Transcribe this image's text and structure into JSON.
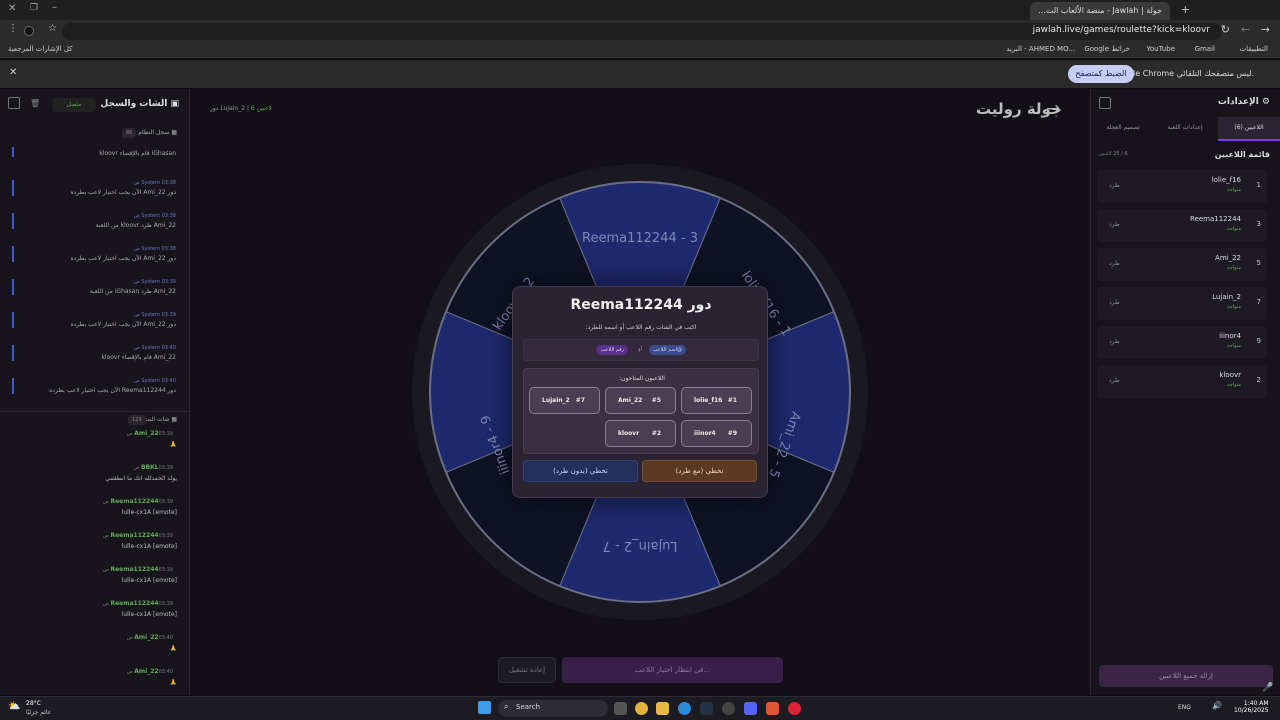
{
  "browser": {
    "tab_title": "جولة | Jawlah - منصة الألعاب الت...",
    "url": "jawlah.live/games/roulette?kick=kloovr",
    "bookmarks": [
      "التطبيقات",
      "Gmail",
      "YouTube",
      "Google خرائط",
      "البريد - AHMED MO...",
      "كل الإشارات المرجعية"
    ],
    "info_text": "Google Chrome ليس متصفحك التلقائي.",
    "info_button": "الضبط كمتصفح تلقائي"
  },
  "header": {
    "title": "جولة روليت",
    "turn_info": "دور Lujain_2",
    "players_count": "6 لاعبين"
  },
  "left": {
    "title": "الشات والسجل",
    "status": "متصل",
    "log_title": "سجل النظام",
    "log_count": "86",
    "chat_title": "شات البث",
    "chat_count": "123",
    "logs": [
      {
        "time": "",
        "text": "iGhasan قام بالإقصاء kloovr"
      },
      {
        "time": "System 03:38 ص",
        "text": "دور Ami_22 الآن يجب اختيار لاعب بطرده"
      },
      {
        "time": "System 03:38 ص",
        "text": "Ami_22 طرد kloovr من اللعبة"
      },
      {
        "time": "System 03:38 ص",
        "text": "دور Ami_22 الآن يجب اختيار لاعب بطرده"
      },
      {
        "time": "System 03:39 ص",
        "text": "Ami_22 طرد iGhasan من اللعبة"
      },
      {
        "time": "System 03:39 ص",
        "text": "دور Ami_22 الآن يجب اختيار لاعب بطرده"
      },
      {
        "time": "System 03:40 ص",
        "text": "Ami_22 قام بالإقصاء kloovr"
      },
      {
        "time": "System 03:40 ص",
        "text": "دور Reema112244 الآن يجب اختيار لاعب بطرده"
      }
    ],
    "chats": [
      {
        "name": "Ami_22",
        "time": "03:39 ص",
        "text": "🙏"
      },
      {
        "name": "BBKL",
        "time": "03:39 ص",
        "text": "يولد الحمدلله انك ما انطقتني"
      },
      {
        "name": "Reema112244",
        "time": "03:39 ص",
        "text": "[emote] lulle-cx1A"
      },
      {
        "name": "Reema112244",
        "time": "03:39 ص",
        "text": "[emote] lulle-cx1A"
      },
      {
        "name": "Reema112244",
        "time": "03:39 ص",
        "text": "[emote] lulle-cx1A"
      },
      {
        "name": "Reema112244",
        "time": "03:39 ص",
        "text": "[emote] lulle-cx1A"
      },
      {
        "name": "Ami_22",
        "time": "03:40 ص",
        "text": "🙏"
      },
      {
        "name": "Ami_22",
        "time": "03:40 ص",
        "text": "🙏"
      }
    ]
  },
  "right": {
    "title": "الإعدادات",
    "tabs": [
      "اللاعبين (6)",
      "إعدادات اللعبة",
      "تصميم العجلة"
    ],
    "list_title": "قائمة اللاعبين",
    "list_count": "6 / 25 لاعبين",
    "remove_all": "إزالة جميع اللاعبين",
    "players": [
      {
        "num": "1",
        "name": "lolie_f16",
        "status": "متواجد",
        "kick": "طرد"
      },
      {
        "num": "3",
        "name": "Reema112244",
        "status": "متواجد",
        "kick": "طرد"
      },
      {
        "num": "5",
        "name": "Ami_22",
        "status": "متواجد",
        "kick": "طرد"
      },
      {
        "num": "7",
        "name": "Lujain_2",
        "status": "متواجد",
        "kick": "طرد"
      },
      {
        "num": "9",
        "name": "iiinor4",
        "status": "متواجد",
        "kick": "طرد"
      },
      {
        "num": "2",
        "name": "kloovr",
        "status": "متواجد",
        "kick": "طرد"
      }
    ]
  },
  "wheel": {
    "labels": [
      "Reema112244 - 3",
      "lolie_f16 - 1",
      "Ami_22 - 5",
      "Lujain_2 - 7",
      "iiinor4 - 9",
      "kloovr - 2"
    ]
  },
  "modal": {
    "title": "دور Reema112244",
    "subtitle": "اكتب في الشات رقم اللاعب أو اسمه للطرد:",
    "hint_name": "@اسم اللاعب",
    "hint_or": "أو",
    "hint_num": "رقم اللاعب",
    "candidates_title": "اللاعبون المتاحون:",
    "candidates": [
      {
        "num": "#1",
        "name": "lolie_f16"
      },
      {
        "num": "#5",
        "name": "Ami_22"
      },
      {
        "num": "#7",
        "name": "Lujain_2"
      },
      {
        "num": "#9",
        "name": "iiinor4"
      },
      {
        "num": "#2",
        "name": "kloovr"
      }
    ],
    "skip_with_kick": "تخطي (مع طرد)",
    "skip_no_kick": "تخطي (بدون طرد)"
  },
  "bottom": {
    "waiting": "في انتظار اختيار اللاعب...",
    "restart": "إعادة تشغيل"
  },
  "taskbar": {
    "weather_temp": "28°C",
    "weather_text": "غائم جزئيًا",
    "search": "Search",
    "time": "1:40 AM",
    "date": "10/26/2025",
    "lang": "ENG"
  },
  "colors": {
    "accent": "#7c3aed",
    "wheel_blue": "#1e2a6e",
    "wheel_dark": "#0e1224",
    "skip_with": "#5a3a22",
    "skip_without": "#24305c"
  }
}
